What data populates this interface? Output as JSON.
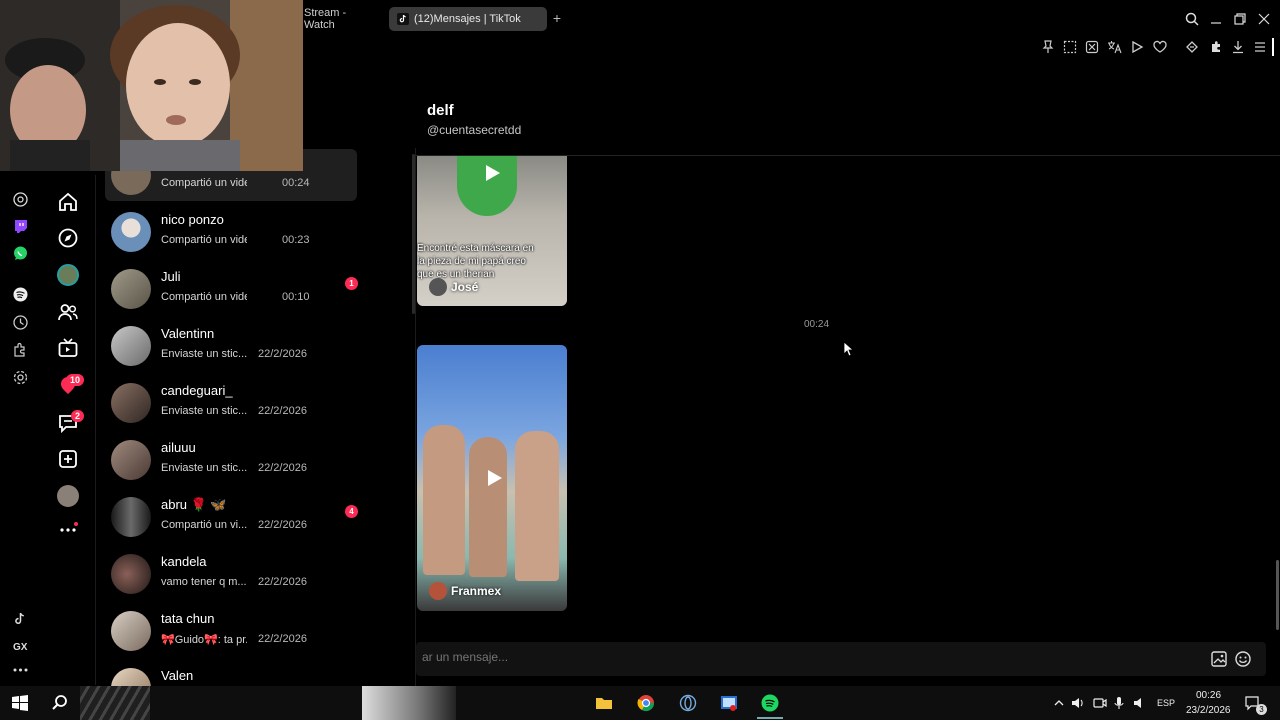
{
  "browser": {
    "tabs": [
      {
        "title": "Stream - Watch",
        "active": false
      },
      {
        "title": "(12)Mensajes | TikTok",
        "active": true
      }
    ],
    "new_tab_label": "+",
    "toolbar_icons": [
      "pin-icon",
      "snapshot-icon",
      "blocker-icon",
      "translate-icon",
      "player-icon",
      "heart-icon",
      "extensions-icon",
      "puzzle-icon",
      "download-icon",
      "menu-icon"
    ]
  },
  "gx_sidebar": {
    "icons": [
      "chatgpt-icon",
      "twitch-icon",
      "whatsapp-icon",
      "spotify-icon",
      "history-icon",
      "extensions-icon",
      "settings-icon"
    ],
    "bottom_icons": [
      "tiktok-icon",
      "gx-icon",
      "more-icon"
    ],
    "gx_label": "GX"
  },
  "tiktok_nav": {
    "icons": [
      "home-icon",
      "explore-icon",
      "avatar-icon",
      "friends-icon",
      "live-icon",
      "activity-icon",
      "messages-icon",
      "upload-icon",
      "profile-icon",
      "more-icon"
    ],
    "activity_badge": "10",
    "messages_badge": "2"
  },
  "conversations": [
    {
      "name": "delf",
      "snippet": "Compartió un video",
      "time": "00:24",
      "unread": "",
      "active": true,
      "avatar_color": "#7a6a5a"
    },
    {
      "name": "nico ponzo",
      "snippet": "Compartió un video",
      "time": "00:23",
      "unread": "",
      "active": false,
      "avatar_color": "#6a8fb8"
    },
    {
      "name": "Juli",
      "snippet": "Compartió un video",
      "time": "00:10",
      "unread": "1",
      "active": false,
      "avatar_color": "#8a8274"
    },
    {
      "name": "Valentinn",
      "snippet": "Enviaste un stic...",
      "time": "22/2/2026",
      "unread": "",
      "active": false,
      "avatar_color": "#9a9a9a"
    },
    {
      "name": "candeguari_",
      "snippet": "Enviaste un stic...",
      "time": "22/2/2026",
      "unread": "",
      "active": false,
      "avatar_color": "#5a4a44"
    },
    {
      "name": "ailuuu",
      "snippet": "Enviaste un stic...",
      "time": "22/2/2026",
      "unread": "",
      "active": false,
      "avatar_color": "#7d6a62"
    },
    {
      "name": "abru 🌹 🦋",
      "snippet": "Compartió un vi...",
      "time": "22/2/2026",
      "unread": "4",
      "active": false,
      "avatar_color": "#3b3b3b"
    },
    {
      "name": "kandela",
      "snippet": "vamo tener q m...",
      "time": "22/2/2026",
      "unread": "",
      "active": false,
      "avatar_color": "#3a302c"
    },
    {
      "name": "tata chun",
      "snippet": "🎀Guido🎀: ta pr...",
      "time": "22/2/2026",
      "unread": "",
      "active": false,
      "avatar_color": "#b6aba0"
    },
    {
      "name": "Valen",
      "snippet": "",
      "time": "",
      "unread": "",
      "active": false,
      "avatar_color": "#c9b59e"
    }
  ],
  "chat": {
    "name": "delf",
    "handle": "@cuentasecretdd",
    "video_1": {
      "caption_lines": [
        "Encontré esta máscara en",
        "la pieza de mi papá creo",
        "que es un therian"
      ],
      "author": "José"
    },
    "timestamp": "00:24",
    "video_2": {
      "author": "Franmex"
    },
    "composer_placeholder": "ar un mensaje..."
  },
  "taskbar": {
    "language": "ESP",
    "time": "00:26",
    "date": "23/2/2026",
    "notifications": "3"
  },
  "colors": {
    "accent": "#fe2c55",
    "background": "#000000",
    "active_row": "#1f1f1f"
  }
}
